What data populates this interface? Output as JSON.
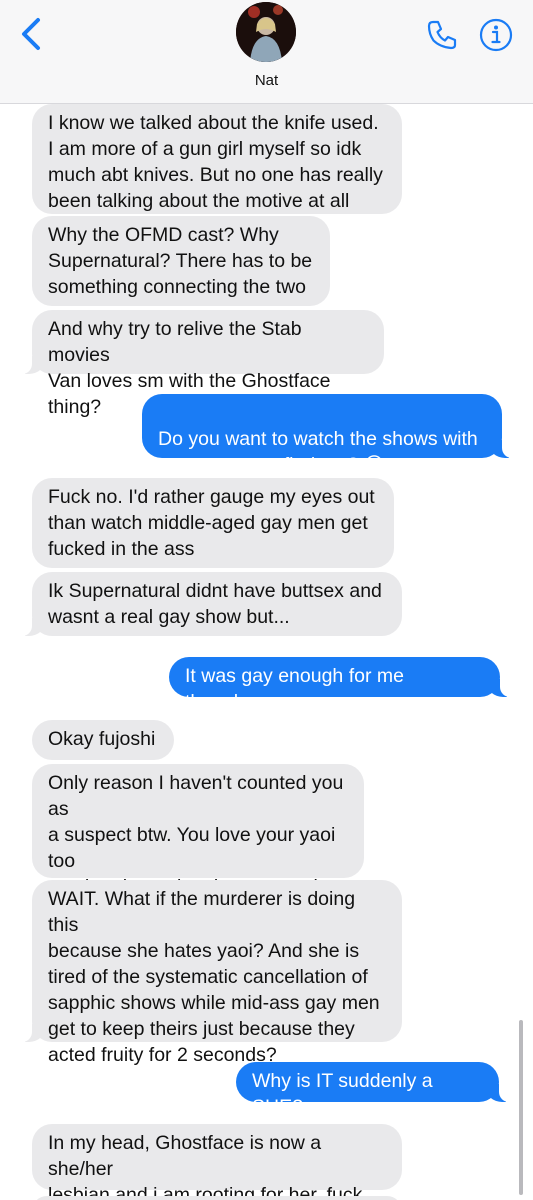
{
  "header": {
    "contact_name": "Nat",
    "back_icon": "chevron-left-icon",
    "call_icon": "phone-icon",
    "info_icon": "info-icon",
    "accent_color": "#1a7cf5"
  },
  "messages": [
    {
      "direction": "incoming",
      "text": "I know we talked about the knife used.\nI am more of a gun girl myself so idk\nmuch abt knives. But no one has really\nbeen talking about the motive at all"
    },
    {
      "direction": "incoming",
      "text": "Why the OFMD cast? Why\nSupernatural? There has to be\nsomething connecting the two"
    },
    {
      "direction": "incoming",
      "text": "And why try to relive the Stab movies\nVan loves sm with the Ghostface thing?"
    },
    {
      "direction": "outgoing",
      "text": "Do you want to watch the shows with\nme so we can find out? 😊"
    },
    {
      "direction": "incoming",
      "text": "Fuck no. I'd rather gauge my eyes out\nthan watch middle-aged gay men get\nfucked in the ass"
    },
    {
      "direction": "incoming",
      "text": "Ik Supernatural didnt have buttsex and\nwasnt a real gay show but..."
    },
    {
      "direction": "outgoing",
      "text": "It was gay enough for me though..."
    },
    {
      "direction": "incoming",
      "text": "Okay fujoshi"
    },
    {
      "direction": "incoming",
      "text": "Only reason I haven't counted you as\na suspect btw. You love your yaoi too\nmuch... the yuri on ice posters in your\nroom 🙄🙄🙄"
    },
    {
      "direction": "incoming",
      "text": "WAIT. What if the murderer is doing this\nbecause she hates yaoi? And she is\ntired of the systematic cancellation of\nsapphic shows while mid-ass gay men\nget to keep theirs just because they\nacted fruity for 2 seconds?"
    },
    {
      "direction": "outgoing",
      "text": "Why is IT suddenly a SHE?"
    },
    {
      "direction": "incoming",
      "text": "In my head, Ghostface is now a she/her\nlesbian and i am rooting for her, fuck off"
    }
  ],
  "colors": {
    "incoming_bubble": "#e9e9eb",
    "outgoing_bubble": "#1a7cf5",
    "header_bg": "#f7f7f8"
  }
}
